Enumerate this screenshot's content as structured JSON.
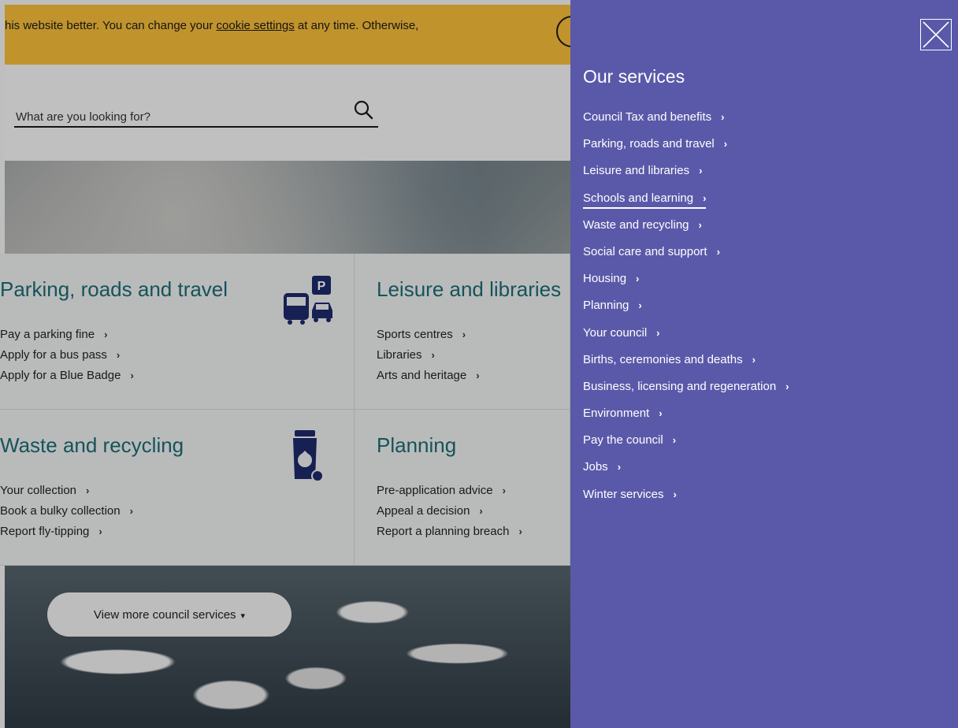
{
  "cookie": {
    "text_before": "his website better. You can change your ",
    "link": "cookie settings",
    "text_after": " at any time. Otherwise,"
  },
  "search": {
    "placeholder": "What are you looking for?"
  },
  "cards": [
    {
      "title": "Parking, roads and travel",
      "links": [
        "Pay a parking fine",
        "Apply for a bus pass",
        "Apply for a Blue Badge"
      ]
    },
    {
      "title": "Leisure and libraries",
      "links": [
        "Sports centres",
        "Libraries",
        "Arts and heritage"
      ]
    },
    {
      "title": "Waste and recycling",
      "links": [
        "Your collection",
        "Book a bulky collection",
        "Report fly-tipping"
      ]
    },
    {
      "title": "Planning",
      "links": [
        "Pre-application advice",
        "Appeal a decision",
        "Report a planning breach"
      ]
    }
  ],
  "view_more": "View more council services",
  "icons": {
    "chevron": "›",
    "caret": "▾"
  },
  "services": {
    "title": "Our services",
    "items": [
      "Council Tax and benefits",
      "Parking, roads and travel",
      "Leisure and libraries",
      "Schools and learning",
      "Waste and recycling",
      "Social care and support",
      "Housing",
      "Planning",
      "Your council",
      "Births, ceremonies and deaths",
      "Business, licensing and regeneration",
      "Environment",
      "Pay the council",
      "Jobs",
      "Winter services"
    ],
    "active_index": 3
  },
  "colors": {
    "panel": "#5a59a9",
    "banner": "#f7bd3a",
    "heading": "#1d6b72",
    "icon": "#1e2a6b"
  }
}
